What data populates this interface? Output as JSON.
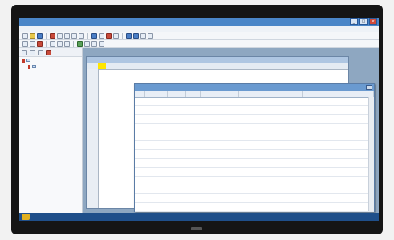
{
  "app": {
    "window_controls": [
      "_",
      "□",
      "×"
    ]
  },
  "menu": {
    "items": []
  },
  "grid_window": {
    "row_numbers": [
      "",
      "",
      "",
      "",
      "",
      "",
      "",
      "",
      "",
      "",
      "",
      "",
      "",
      "",
      "",
      "",
      "",
      "",
      ""
    ]
  },
  "data_window": {
    "columns": [
      12,
      28,
      22,
      18,
      48,
      38,
      40,
      36,
      30,
      22
    ],
    "rows": [
      [
        "",
        "",
        "",
        "",
        "",
        "",
        "",
        "",
        "",
        ""
      ],
      [
        "",
        "",
        "",
        "",
        "",
        "",
        "",
        "",
        "",
        ""
      ],
      [
        "",
        "",
        "",
        "",
        "",
        "",
        "",
        "",
        "",
        ""
      ],
      [
        "",
        "",
        "",
        "",
        "",
        "",
        "",
        "",
        "",
        ""
      ],
      [
        "",
        "",
        "",
        "",
        "",
        "",
        "",
        "",
        "",
        ""
      ],
      [
        "",
        "",
        "",
        "",
        "",
        "",
        "",
        "",
        "",
        ""
      ],
      [
        "",
        "",
        "",
        "",
        "",
        "",
        "",
        "",
        "",
        ""
      ],
      [
        "",
        "",
        "",
        "",
        "",
        "",
        "",
        "",
        "",
        ""
      ],
      [
        "",
        "",
        "",
        "",
        "",
        "",
        "",
        "",
        "",
        ""
      ],
      [
        "",
        "",
        "",
        "",
        "",
        "",
        "",
        "",
        "",
        ""
      ],
      [
        "",
        "",
        "",
        "",
        "",
        "",
        "",
        "",
        "",
        ""
      ],
      [
        "",
        "",
        "",
        "",
        "",
        "",
        "",
        "",
        "",
        ""
      ],
      [
        "",
        "",
        "",
        "",
        "",
        "",
        "",
        "",
        "",
        ""
      ],
      [
        "",
        "",
        "",
        "",
        "",
        "",
        "",
        "",
        "",
        ""
      ]
    ]
  },
  "colors": {
    "titlebar": "#4a86c8",
    "mdi_background": "#8ea7c1",
    "cell_highlight": "#ffe600",
    "taskbar": "#1f4f8a"
  },
  "icons": {
    "toolbar": [
      "new-icon",
      "open-icon",
      "save-icon",
      "print-icon",
      "cut-icon",
      "copy-icon",
      "paste-icon",
      "undo-icon",
      "redo-icon",
      "chart-icon",
      "table-icon",
      "filter-icon",
      "sort-icon"
    ]
  }
}
